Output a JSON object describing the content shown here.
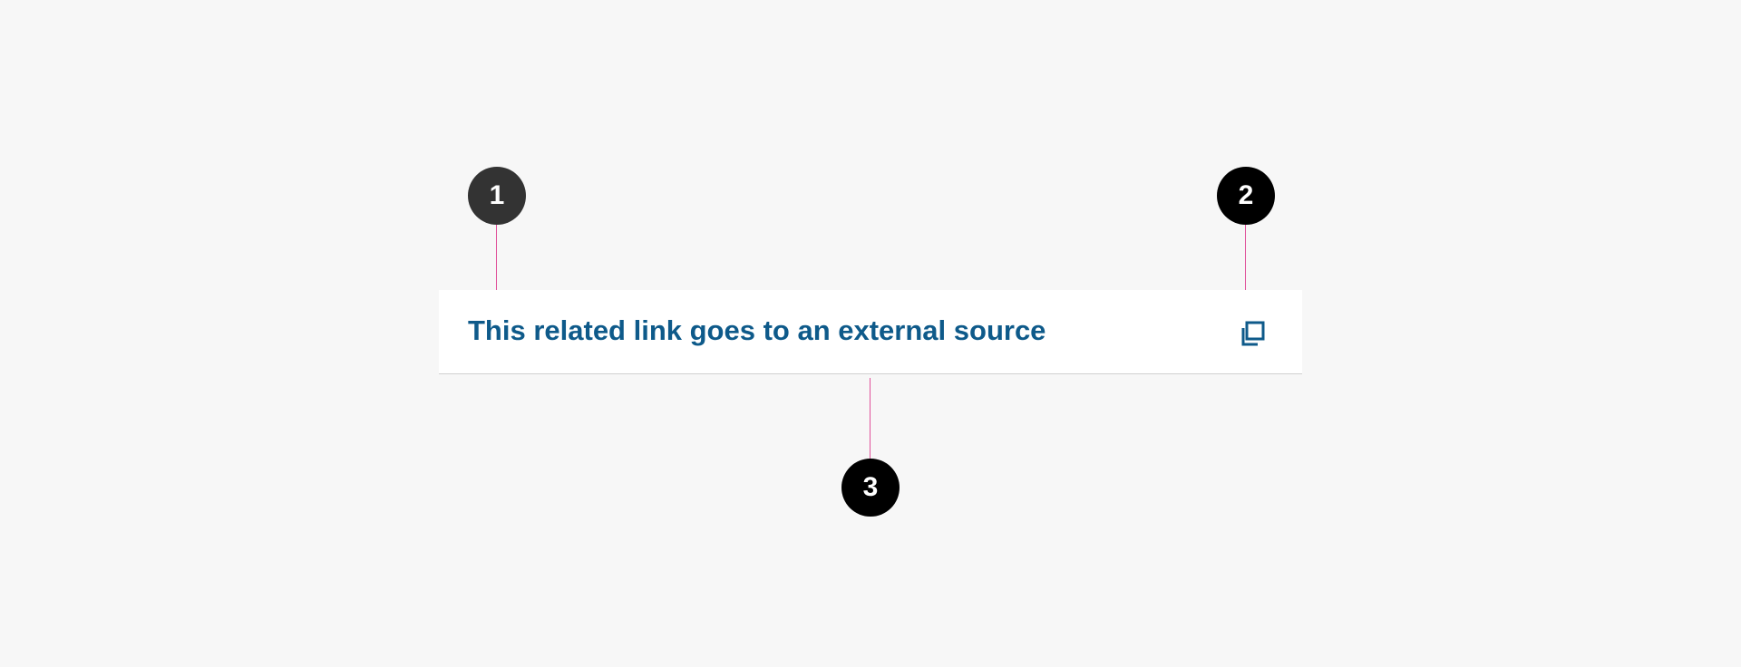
{
  "link": {
    "text": "This related link goes to an external source",
    "icon": "external-link-icon",
    "text_color": "#0e5a8a"
  },
  "callouts": [
    {
      "number": "1",
      "target": "link-text"
    },
    {
      "number": "2",
      "target": "external-link-icon"
    },
    {
      "number": "3",
      "target": "bottom-border"
    }
  ],
  "colors": {
    "background": "#f7f7f7",
    "card": "#ffffff",
    "leader_line": "#e0509a",
    "badge_primary": "#333333",
    "badge": "#000000"
  }
}
